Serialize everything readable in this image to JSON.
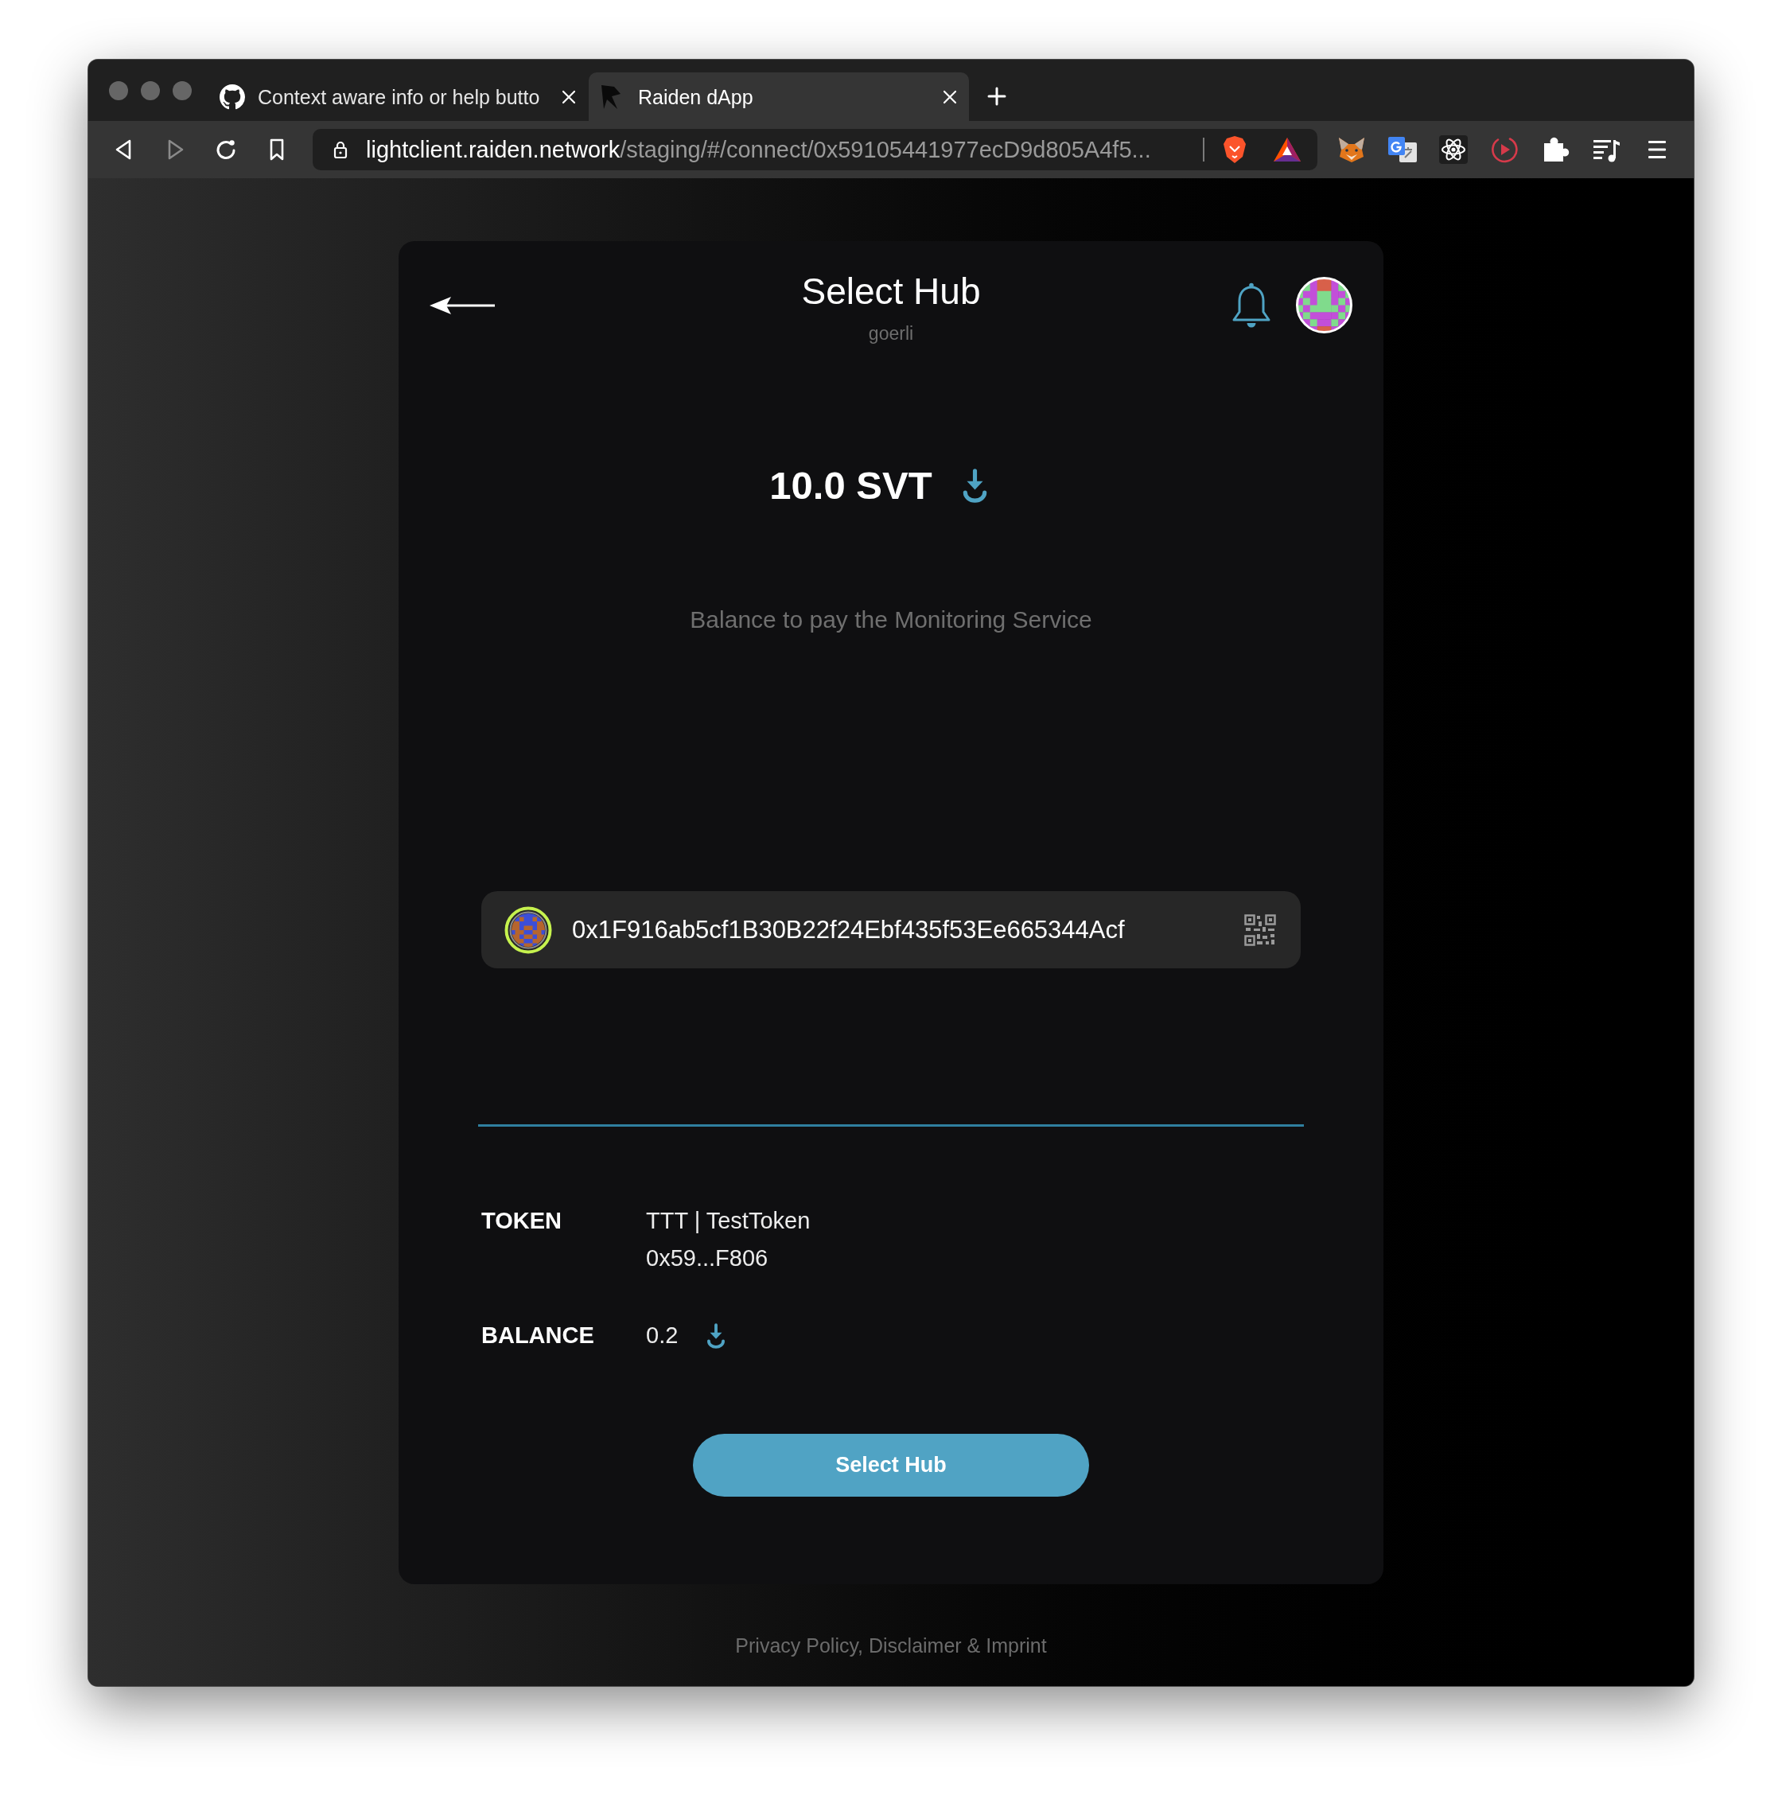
{
  "browser": {
    "tabs": [
      {
        "title": "Context aware info or help butto",
        "selected": false
      },
      {
        "title": "Raiden dApp",
        "selected": true
      }
    ],
    "address_bar": {
      "host": "lightclient.raiden.network",
      "path": "/staging/#/connect/0x59105441977ecD9d805A4f5..."
    }
  },
  "header": {
    "title": "Select Hub",
    "subtitle": "goerli"
  },
  "monitoring": {
    "amount": "10.0 SVT",
    "description": "Balance to pay the Monitoring Service"
  },
  "hub_address": {
    "value": "0x1F916ab5cf1B30B22f24Ebf435f53Ee665344Acf"
  },
  "details": [
    {
      "kind": "token",
      "label": "TOKEN",
      "lines": [
        "TTT | TestToken",
        "0x59...F806"
      ]
    },
    {
      "kind": "balance",
      "label": "BALANCE",
      "lines": [
        "0.2"
      ]
    }
  ],
  "select_button": {
    "label": "Select Hub"
  },
  "footer": {
    "link": "Privacy Policy, Disclaimer & Imprint"
  }
}
